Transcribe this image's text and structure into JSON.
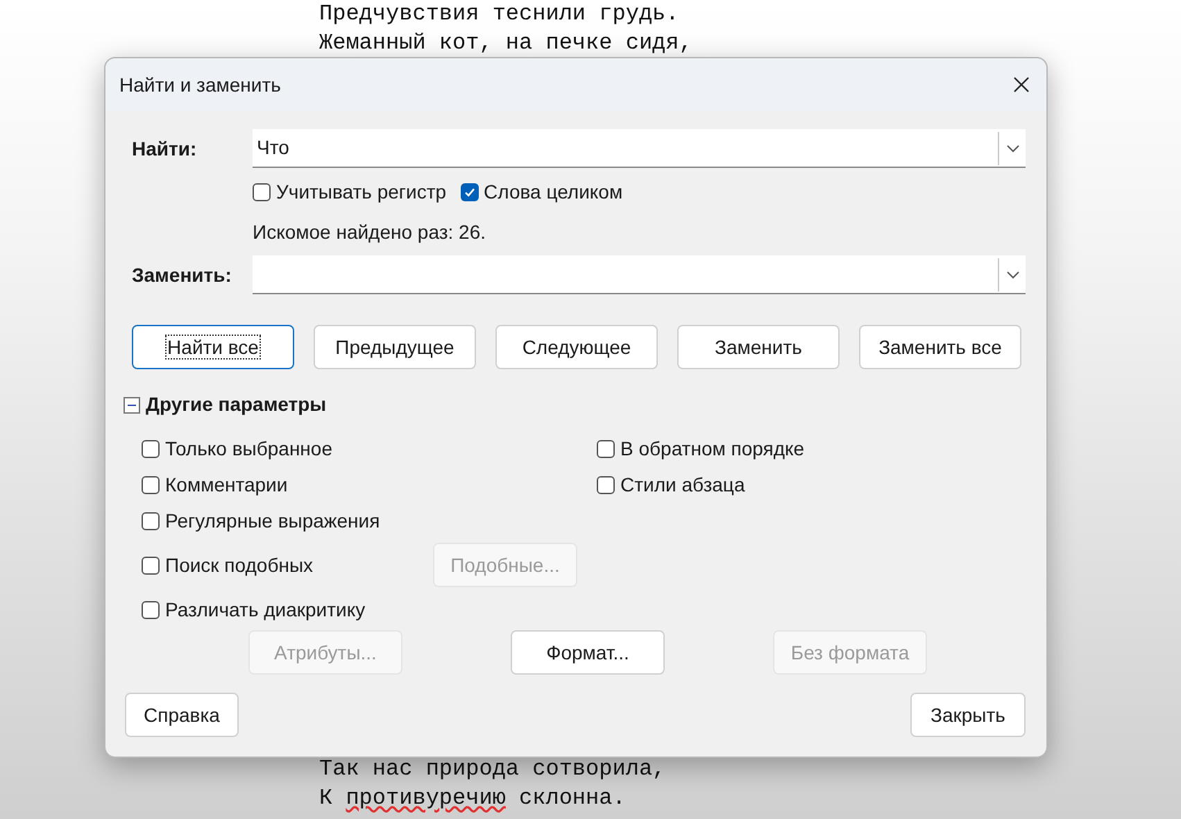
{
  "document": {
    "top_lines": [
      [
        {
          "text": "Предчувствия теснили грудь.",
          "misspelled": false
        }
      ],
      [
        {
          "text": "Жеманный кот, на печке сидя,",
          "misspelled": false
        }
      ]
    ],
    "bottom_lines": [
      [
        {
          "text": "Так нас природа сотворила,",
          "misspelled": false
        }
      ],
      [
        {
          "text": "К ",
          "misspelled": false
        },
        {
          "text": "противуречию",
          "misspelled": true
        },
        {
          "text": " склонна.",
          "misspelled": false
        }
      ]
    ]
  },
  "window": {
    "title": "Найти и заменить"
  },
  "find": {
    "label": "Найти:",
    "value": "Что"
  },
  "find_options": [
    {
      "label": "Учитывать регистр",
      "checked": false
    },
    {
      "label": "Слова целиком",
      "checked": true
    }
  ],
  "found_count": "Искомое найдено раз: 26.",
  "replace": {
    "label": "Заменить:"
  },
  "buttons": [
    {
      "label": "Найти все",
      "focused": true
    },
    {
      "label": "Предыдущее",
      "focused": false
    },
    {
      "label": "Следующее",
      "focused": false
    },
    {
      "label": "Заменить",
      "focused": false
    },
    {
      "label": "Заменить все",
      "focused": false
    }
  ],
  "other_params": {
    "label": "Другие параметры",
    "expanded": true,
    "left_options": [
      {
        "label": "Только выбранное",
        "checked": false
      },
      {
        "label": "Комментарии",
        "checked": false
      },
      {
        "label": "Регулярные выражения",
        "checked": false
      },
      {
        "label": "Поиск подобных",
        "checked": false,
        "button": {
          "label": "Подобные...",
          "disabled": true
        }
      },
      {
        "label": "Различать диакритику",
        "checked": false
      }
    ],
    "right_options": [
      {
        "label": "В обратном порядке",
        "checked": false
      },
      {
        "label": "Стили абзаца",
        "checked": false
      }
    ],
    "format_buttons": [
      {
        "label": "Атрибуты...",
        "disabled": true
      },
      {
        "label": "Формат...",
        "disabled": false
      },
      {
        "label": "Без формата",
        "disabled": true
      }
    ]
  },
  "footer": {
    "help": "Справка",
    "close": "Закрыть"
  }
}
